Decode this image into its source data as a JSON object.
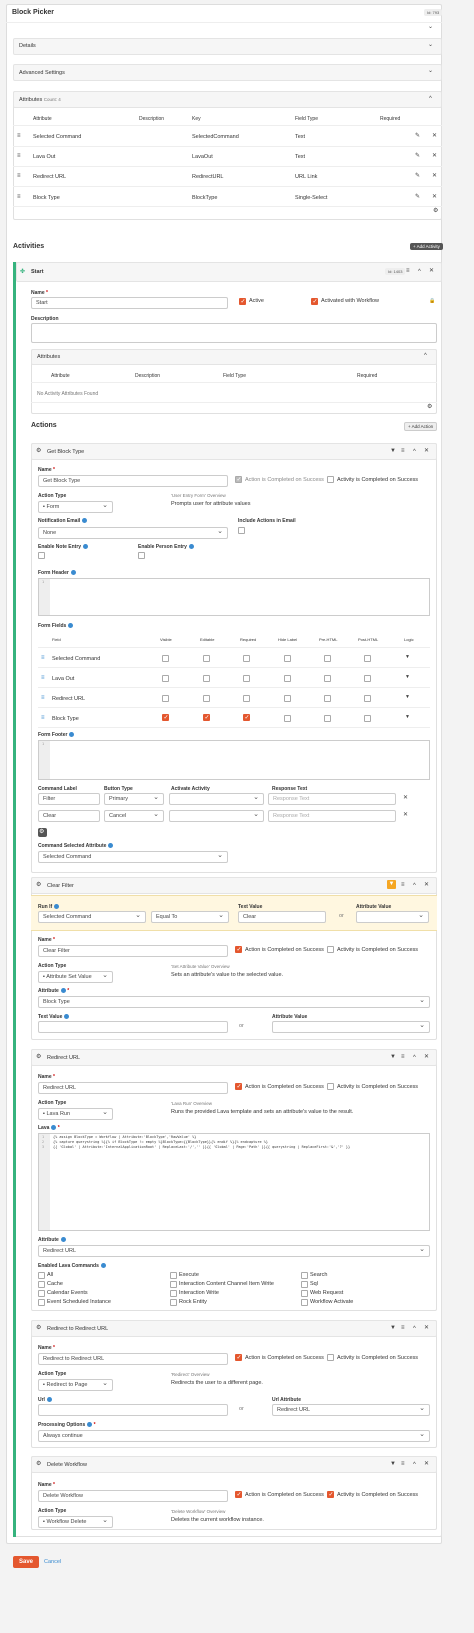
{
  "header": {
    "title": "Block Picker",
    "badge": "Id: 793"
  },
  "panels": {
    "details": "Details",
    "advanced": "Advanced Settings"
  },
  "attributes": {
    "title": "Attributes",
    "count": "Count: 4",
    "cols": [
      "Attribute",
      "Description",
      "Key",
      "Field Type",
      "Required"
    ],
    "rows": [
      {
        "name": "Selected Command",
        "desc": "",
        "key": "SelectedCommand",
        "type": "Text"
      },
      {
        "name": "Lava Out",
        "desc": "",
        "key": "LavaOut",
        "type": "Text"
      },
      {
        "name": "Redirect URL",
        "desc": "",
        "key": "RedirectURL",
        "type": "URL Link"
      },
      {
        "name": "Block Type",
        "desc": "",
        "key": "BlockType",
        "type": "Single-Select"
      }
    ]
  },
  "activities": {
    "title": "Activities",
    "add": "+ Add Activity"
  },
  "activity": {
    "title": "Start",
    "badge": "Id: 1403",
    "name_label": "Name",
    "name": "Start",
    "active": "Active",
    "activated": "Activated with Workflow",
    "desc_label": "Description",
    "attr_title": "Attributes",
    "attr_cols": [
      "Attribute",
      "Description",
      "Field Type",
      "Required"
    ],
    "attr_empty": "No Activity Attributes Found",
    "actions_title": "Actions",
    "add_action": "+ Add Action"
  },
  "common": {
    "name": "Name",
    "action_type": "Action Type",
    "completed": "Action is Completed on Success",
    "activity_completed": "Activity is Completed on Success"
  },
  "a1": {
    "title": "Get Block Type",
    "name": "Get Block Type",
    "type": "Form",
    "ov_title": "'User Entry Form' Overview",
    "ov_text": "Prompts user for attribute values",
    "notif_label": "Notification Email",
    "notif": "None",
    "incl_label": "Include Actions in Email",
    "note_label": "Enable Note Entry",
    "person_label": "Enable Person Entry",
    "header_label": "Form Header",
    "fields_label": "Form Fields",
    "fields_cols": [
      "Field",
      "Visible",
      "Editable",
      "Required",
      "Hide Label",
      "Pre-HTML",
      "Post-HTML",
      "Logic"
    ],
    "fields": [
      "Selected Command",
      "Lava Out",
      "Redirect URL",
      "Block Type"
    ],
    "footer_label": "Form Footer",
    "cmd_cols": [
      "Command Label",
      "Button Type",
      "Activate Activity",
      "Response Text"
    ],
    "cmds": [
      {
        "label": "Filter",
        "type": "Primary",
        "resp": "Response Text"
      },
      {
        "label": "Clear",
        "type": "Cancel",
        "resp": "Response Text"
      }
    ],
    "csa_label": "Command Selected Attribute",
    "csa": "Selected Command"
  },
  "a2": {
    "title": "Clear Filter",
    "runif": "Run If",
    "runif_attr": "Selected Command",
    "runif_op": "Equal To",
    "tv_label": "Text Value",
    "tv": "Clear",
    "or": "or",
    "av_label": "Attribute Value",
    "name": "Clear Filter",
    "type": "Attribute Set Value",
    "ov_title": "'Set Attribute Value' Overview",
    "ov_text": "Sets an attribute's value to the selected value.",
    "attr_label": "Attribute",
    "attr": "Block Type",
    "text_label": "Text Value",
    "attrval_label": "Attribute Value"
  },
  "a3": {
    "title": "Redirect URL",
    "name": "Redirect URL",
    "type": "Lava Run",
    "ov_title": "'Lava Run' Overview",
    "ov_text": "Runs the provided Lava template and sets an attribute's value to the result.",
    "lava_label": "Lava",
    "code": [
      "{% assign BlockType = Workflow | Attribute:'BlockType','RawValue' %}",
      "{% capture querystring %}{% if BlockType != empty %}BlockType={{BlockType}}{% endif %}{% endcapture %}",
      "{{ 'Global' | Attribute:'InternalApplicationRoot' | ReplaceLast:'/','' }}{{ 'Global' | Page:'Path' }}{{ querystring | ReplaceFirst:'&','?' }}"
    ],
    "attr_label": "Attribute",
    "attr": "Redirect URL",
    "cmds_label": "Enabled Lava Commands",
    "cmds": [
      [
        "All",
        "Cache",
        "Calendar Events",
        "Event Scheduled Instance"
      ],
      [
        "Execute",
        "Interaction Content Channel Item Write",
        "Interaction Write",
        "Rock Entity"
      ],
      [
        "Search",
        "Sql",
        "Web Request",
        "Workflow Activate"
      ]
    ]
  },
  "a4": {
    "title": "Redirect to Redirect URL",
    "name": "Redirect to Redirect URL",
    "type": "Redirect to Page",
    "ov_title": "'Redirect' Overview",
    "ov_text": "Redirects the user to a different page.",
    "url_label": "Url",
    "or": "or",
    "urlattr_label": "Url Attribute",
    "urlattr": "Redirect URL",
    "proc_label": "Processing Options",
    "proc": "Always continue"
  },
  "a5": {
    "title": "Delete Workflow",
    "name": "Delete Workflow",
    "type": "Workflow Delete",
    "ov_title": "'Delete Workflow' Overview",
    "ov_text": "Deletes the current workflow instance."
  },
  "footer": {
    "save": "Save",
    "cancel": "Cancel"
  },
  "colors": {
    "accent": "#e4572e",
    "green": "#36b37e",
    "info": "#3a8bd0",
    "filter_bg": "#fff7e0"
  }
}
